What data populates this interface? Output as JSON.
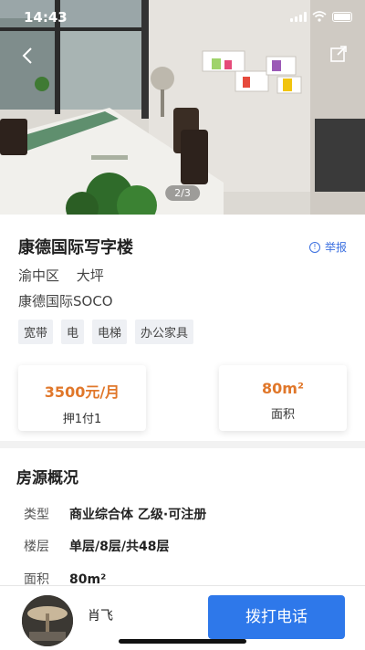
{
  "status": {
    "time": "14:43"
  },
  "gallery": {
    "counter": "2/3"
  },
  "listing": {
    "title": "康德国际写字楼",
    "report_label": "举报",
    "district": "渝中区",
    "area_name": "大坪",
    "building": "康德国际SOCO",
    "tags": [
      "宽带",
      "电",
      "电梯",
      "办公家具"
    ]
  },
  "stats": {
    "price": {
      "value": "3500元/月",
      "label": "押1付1"
    },
    "area": {
      "value": "80m²",
      "label": "面积"
    }
  },
  "overview": {
    "title": "房源概况",
    "rows": [
      {
        "k": "类型",
        "v": "商业综合体 乙级·可注册"
      },
      {
        "k": "楼层",
        "v": "单层/8层/共48层"
      },
      {
        "k": "面积",
        "v": "80m²"
      }
    ]
  },
  "agent": {
    "name": "肖飞"
  },
  "actions": {
    "call_label": "拨打电话"
  },
  "icons": [
    "back-icon",
    "share-icon",
    "report-icon",
    "wifi-icon",
    "signal-icon",
    "battery-icon"
  ],
  "colors": {
    "accent": "#2e78ea",
    "price": "#e0772a",
    "link": "#3b6fe0"
  }
}
